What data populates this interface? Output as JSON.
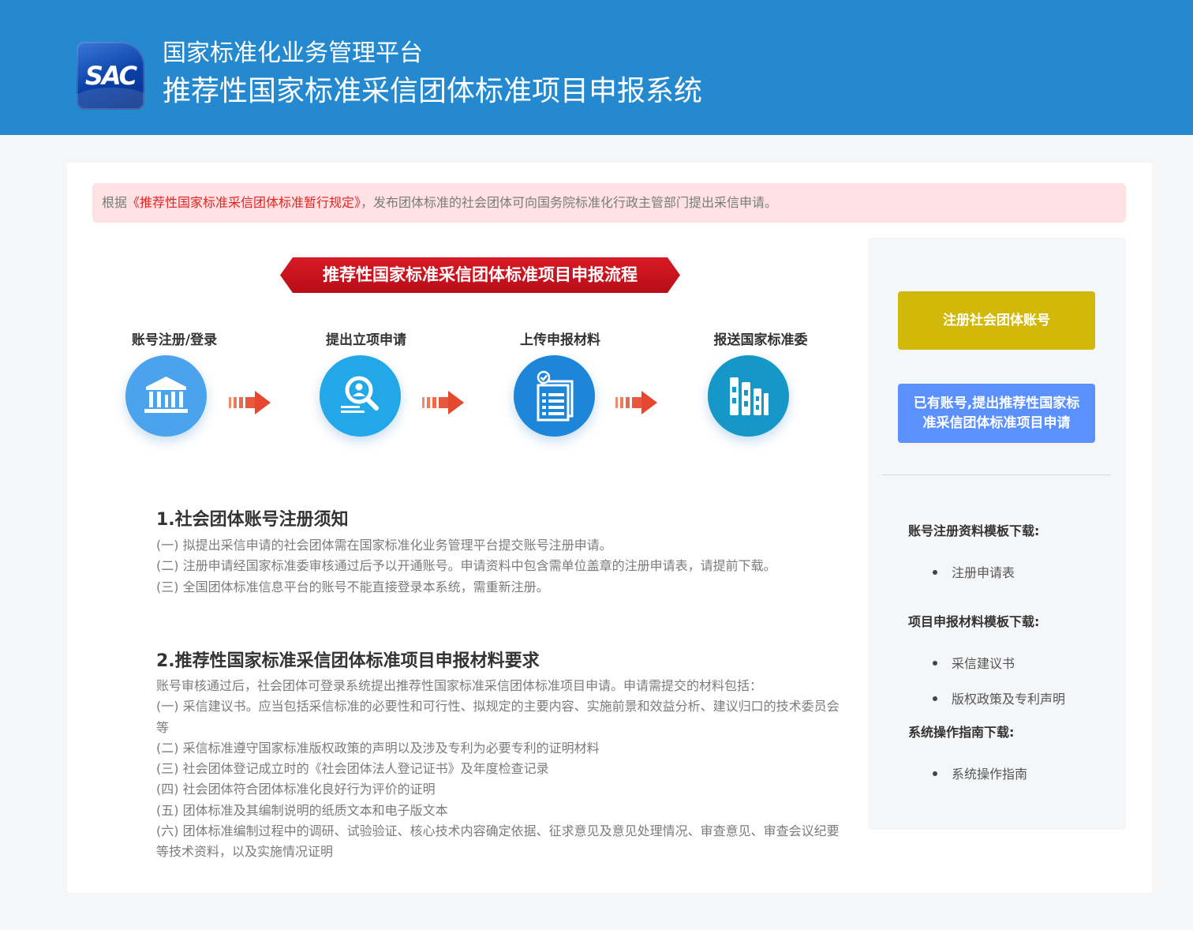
{
  "header": {
    "logo_text": "SAC",
    "subtitle": "国家标准化业务管理平台",
    "title": "推荐性国家标准采信团体标准项目申报系统"
  },
  "notice": {
    "prefix": "根据",
    "link": "《推荐性国家标准采信团体标准暂行规定》",
    "suffix": "，发布团体标准的社会团体可向国务院标准化行政主管部门提出采信申请。"
  },
  "flow": {
    "banner": "推荐性国家标准采信团体标准项目申报流程",
    "steps": [
      {
        "label": "账号注册/登录",
        "icon": "bank-icon",
        "color": "#4aa3ec"
      },
      {
        "label": "提出立项申请",
        "icon": "search-person-icon",
        "color": "#22a7e8"
      },
      {
        "label": "上传申报材料",
        "icon": "document-list-icon",
        "color": "#1e86d8"
      },
      {
        "label": "报送国家标准委",
        "icon": "binders-icon",
        "color": "#1597c8"
      }
    ]
  },
  "section1": {
    "title": "1.社会团体账号注册须知",
    "lines": [
      "(一) 拟提出采信申请的社会团体需在国家标准化业务管理平台提交账号注册申请。",
      "(二) 注册申请经国家标准委审核通过后予以开通账号。申请资料中包含需单位盖章的注册申请表，请提前下载。",
      "(三) 全国团体标准信息平台的账号不能直接登录本系统，需重新注册。"
    ]
  },
  "section2": {
    "title": "2.推荐性国家标准采信团体标准项目申报材料要求",
    "lines": [
      "账号审核通过后，社会团体可登录系统提出推荐性国家标准采信团体标准项目申请。申请需提交的材料包括：",
      "(一) 采信建议书。应当包括采信标准的必要性和可行性、拟规定的主要内容、实施前景和效益分析、建议归口的技术委员会等",
      "(二) 采信标准遵守国家标准版权政策的声明以及涉及专利为必要专利的证明材料",
      "(三) 社会团体登记成立时的《社会团体法人登记证书》及年度检查记录",
      "(四) 社会团体符合团体标准化良好行为评价的证明",
      "(五) 团体标准及其编制说明的纸质文本和电子版文本",
      "(六) 团体标准编制过程中的调研、试验验证、核心技术内容确定依据、征求意见及意见处理情况、审查意见、审查会议纪要等技术资料，以及实施情况证明"
    ]
  },
  "sidebar": {
    "register_button": "注册社会团体账号",
    "apply_button": "已有账号,提出推荐性国家标准采信团体标准项目申请",
    "groups": [
      {
        "heading": "账号注册资料模板下载:",
        "items": [
          "注册申请表"
        ]
      },
      {
        "heading": "项目申报材料模板下载:",
        "items": [
          "采信建议书",
          "版权政策及专利声明"
        ]
      },
      {
        "heading": "系统操作指南下载:",
        "items": [
          "系统操作指南"
        ]
      }
    ]
  },
  "colors": {
    "header_bg": "#2589cf",
    "banner_red": "#c8101e",
    "notice_bg": "#fde1e3",
    "register_button": "#d2b909",
    "apply_button": "#5a91ff"
  }
}
